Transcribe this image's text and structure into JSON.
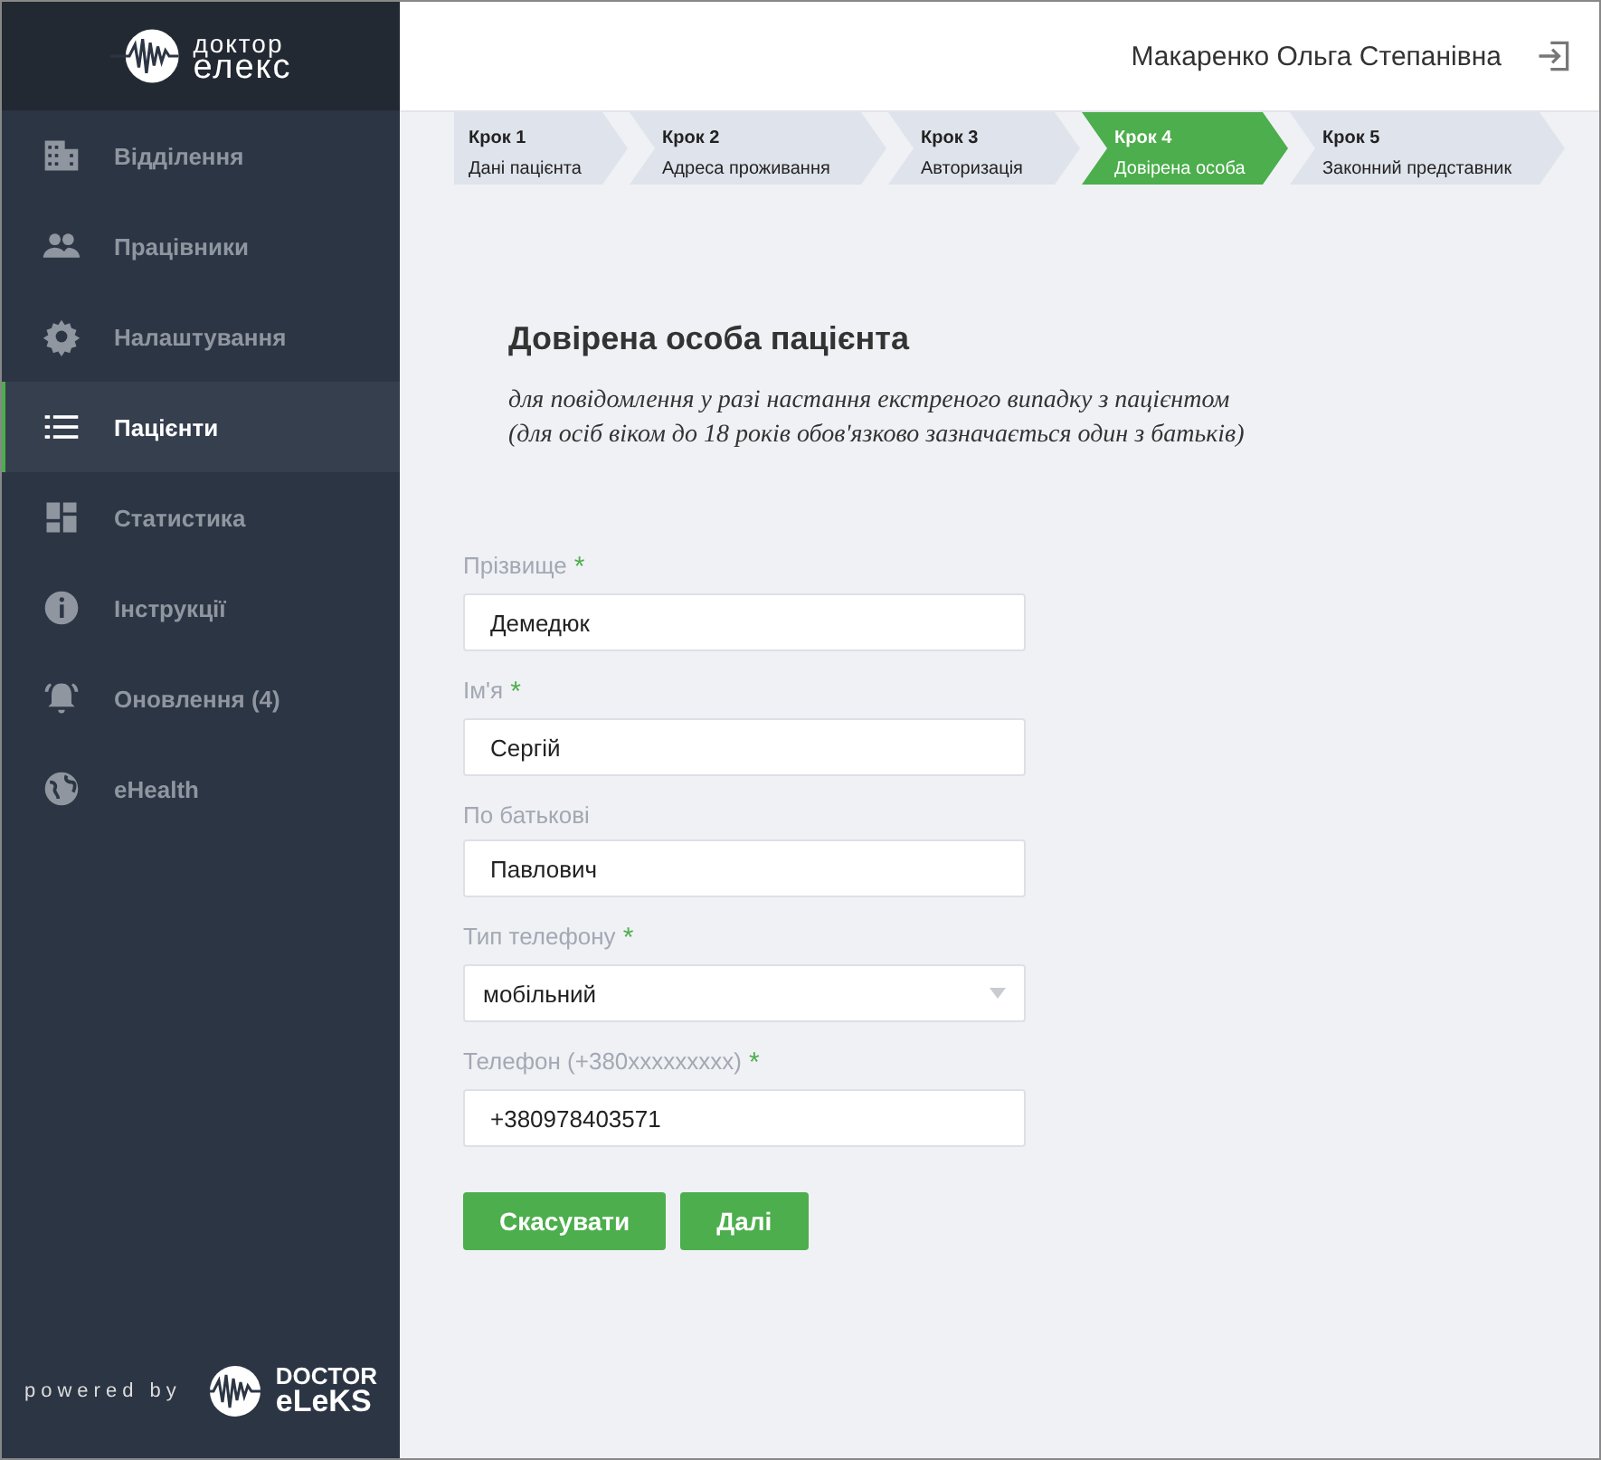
{
  "logo": {
    "line1": "доктор",
    "line2": "елекс"
  },
  "user": {
    "name": "Макаренко Ольга Степанівна"
  },
  "sidebar": {
    "items": [
      {
        "label": "Відділення",
        "selected": false
      },
      {
        "label": "Працівники",
        "selected": false
      },
      {
        "label": "Налаштування",
        "selected": false
      },
      {
        "label": "Пацієнти",
        "selected": true
      },
      {
        "label": "Статистика",
        "selected": false
      },
      {
        "label": "Інструкції",
        "selected": false
      },
      {
        "label": "Оновлення (4)",
        "selected": false
      },
      {
        "label": "eHealth",
        "selected": false
      }
    ]
  },
  "footer": {
    "powered": "powered by",
    "brand1": "DOCTOR",
    "brand2": "eLeKS"
  },
  "steps": [
    {
      "step": "Крок 1",
      "label": "Дані пацієнта",
      "selected": false
    },
    {
      "step": "Крок 2",
      "label": "Адреса проживання",
      "selected": false
    },
    {
      "step": "Крок 3",
      "label": "Авторизація",
      "selected": false
    },
    {
      "step": "Крок 4",
      "label": "Довірена особа",
      "selected": true
    },
    {
      "step": "Крок 5",
      "label": "Законний представник",
      "selected": false
    }
  ],
  "form": {
    "title": "Довірена особа пацієнта",
    "note_lines": [
      "для повідомлення у разі настання екстреного випадку з пацієнтом",
      "(для осіб віком до 18 років обов'язково зазначається один з батьків)"
    ],
    "fields": [
      {
        "kind": "text",
        "label": "Прізвище",
        "required": true,
        "value": "Демедюк"
      },
      {
        "kind": "text",
        "label": "Ім'я",
        "required": true,
        "value": "Сергій"
      },
      {
        "kind": "text",
        "label": "По батькові",
        "required": false,
        "value": "Павлович"
      },
      {
        "kind": "select",
        "label": "Тип телефону",
        "required": true,
        "value": "мобільний"
      },
      {
        "kind": "text",
        "label": "Телефон (+380xxxxxxxxx)",
        "required": true,
        "value": "+380978403571"
      }
    ],
    "required_mark": "*",
    "buttons": [
      "Скасувати",
      "Далі"
    ]
  }
}
